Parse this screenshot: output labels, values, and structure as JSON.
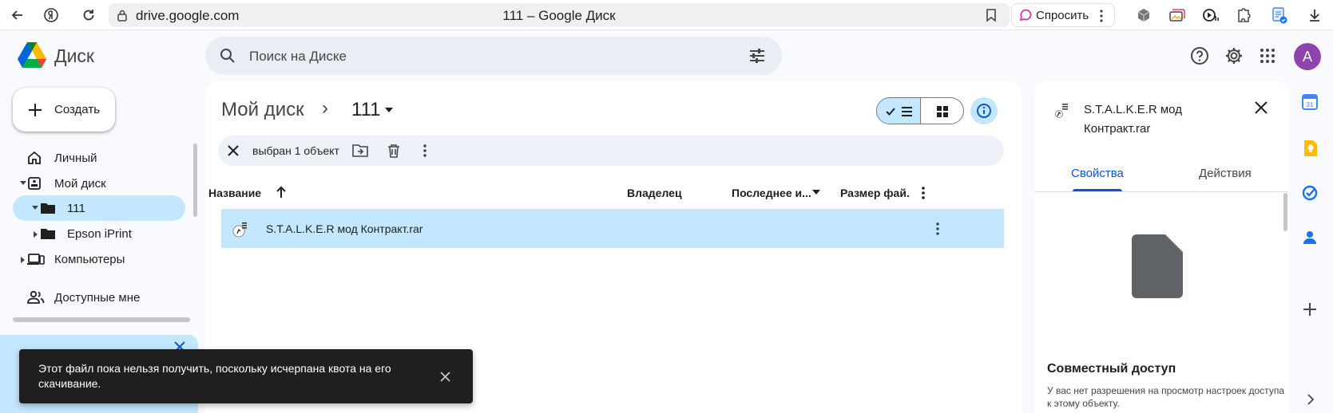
{
  "browser": {
    "url": "drive.google.com",
    "tab_title": "111 – Google Диск",
    "ask_label": "Спросить"
  },
  "app": {
    "name": "Диск",
    "search_placeholder": "Поиск на Диске",
    "avatar_letter": "A",
    "create_label": "Создать"
  },
  "sidebar": {
    "items": [
      {
        "label": "Личный"
      },
      {
        "label": "Мой диск"
      },
      {
        "label": "111"
      },
      {
        "label": "Epson iPrint"
      },
      {
        "label": "Компьютеры"
      },
      {
        "label": "Доступные мне"
      }
    ]
  },
  "main": {
    "breadcrumb_root": "Мой диск",
    "breadcrumb_sep": "›",
    "breadcrumb_current": "111",
    "selection_text": "выбран 1 объект",
    "columns": {
      "name": "Название",
      "owner": "Владелец",
      "modified": "Последнее и...",
      "size": "Размер фай."
    },
    "rows": [
      {
        "name": "S.T.A.L.K.E.R мод Контракт.rar"
      }
    ]
  },
  "details": {
    "title": "S.T.A.L.K.E.R мод Контракт.rar",
    "tab_properties": "Свойства",
    "tab_actions": "Действия",
    "share_heading": "Совместный доступ",
    "share_text": "У вас нет разрешения на просмотр настроек доступа к этому объекту."
  },
  "toast": {
    "message": "Этот файл пока нельзя получить, поскольку исчерпана квота на его скачивание."
  },
  "colors": {
    "accent": "#0b57d0",
    "selected": "#c2e7ff",
    "toast_bg": "#1f1f1f"
  }
}
